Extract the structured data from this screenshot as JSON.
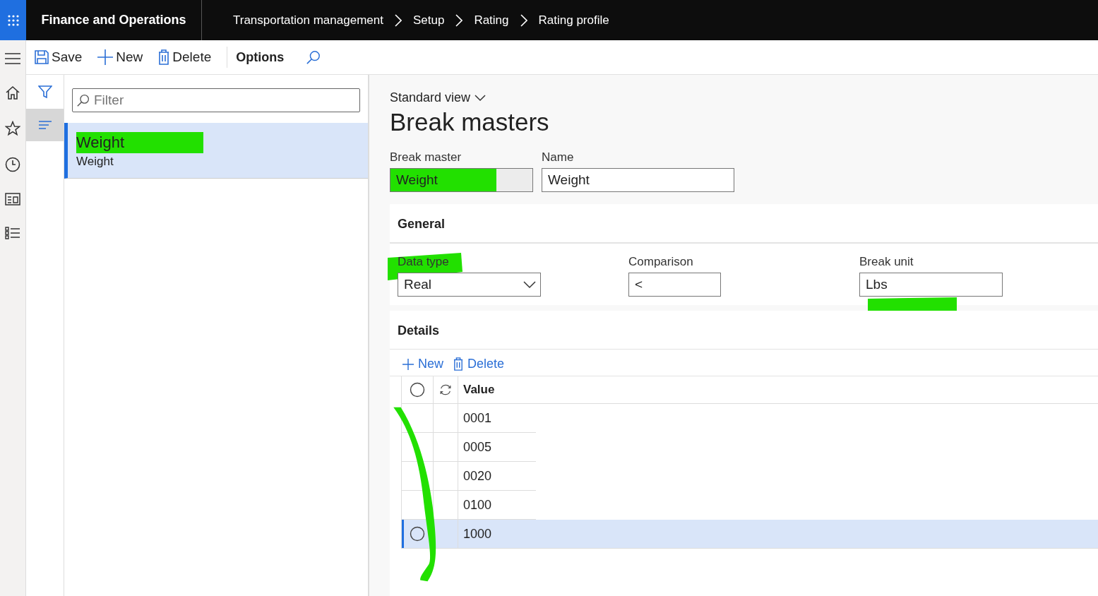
{
  "app_title": "Finance and Operations",
  "breadcrumb": [
    "Transportation management",
    "Setup",
    "Rating",
    "Rating profile"
  ],
  "actions": [
    {
      "label": "Save",
      "kind": "save"
    },
    {
      "label": "New",
      "kind": "new"
    },
    {
      "label": "Delete",
      "kind": "delete"
    },
    {
      "label": "Options",
      "kind": "text"
    }
  ],
  "list": {
    "filter_placeholder": "Filter",
    "items": [
      {
        "title": "Weight",
        "subtitle": "Weight",
        "selected": true,
        "highlighted": true
      }
    ]
  },
  "view_name": "Standard view",
  "page_title": "Break masters",
  "header_fields": [
    {
      "label": "Break master",
      "value": "Weight",
      "locked": true,
      "highlighted": true
    },
    {
      "label": "Name",
      "value": "Weight",
      "locked": false,
      "highlighted": false
    }
  ],
  "general": {
    "title": "General",
    "fields": [
      {
        "label": "Data type",
        "value": "Real",
        "kind": "dropdown",
        "label_highlighted": true,
        "underlined": false
      },
      {
        "label": "Comparison",
        "value": "<",
        "kind": "text",
        "label_highlighted": false,
        "underlined": false
      },
      {
        "label": "Break unit",
        "value": "Lbs",
        "kind": "text",
        "label_highlighted": false,
        "underlined": true
      }
    ]
  },
  "details": {
    "title": "Details",
    "marked": true,
    "all_selected": false,
    "actions": [
      {
        "label": "New",
        "kind": "new"
      },
      {
        "label": "Delete",
        "kind": "delete"
      }
    ],
    "column": "Value",
    "rows": [
      {
        "value": "0001",
        "selected": false
      },
      {
        "value": "0005",
        "selected": false
      },
      {
        "value": "0020",
        "selected": false
      },
      {
        "value": "0100",
        "selected": false
      },
      {
        "value": "1000",
        "selected": true
      }
    ]
  }
}
